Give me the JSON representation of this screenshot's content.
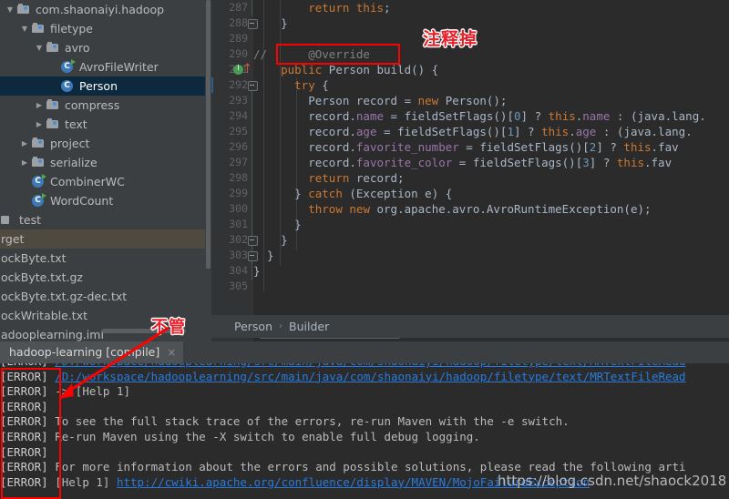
{
  "sidebar": {
    "tree": [
      {
        "depth": 0,
        "twisty": "▼",
        "icon": "folder-icon",
        "label": "com.shaonaiyi.hadoop",
        "state": "normal"
      },
      {
        "depth": 1,
        "twisty": "▼",
        "icon": "folder-icon",
        "label": "filetype",
        "state": "normal"
      },
      {
        "depth": 2,
        "twisty": "▼",
        "icon": "folder-icon",
        "label": "avro",
        "state": "normal"
      },
      {
        "depth": 3,
        "twisty": "",
        "icon": "java-class-runnable-icon",
        "label": "AvroFileWriter",
        "state": "normal"
      },
      {
        "depth": 3,
        "twisty": "",
        "icon": "java-class-icon",
        "label": "Person",
        "state": "selected"
      },
      {
        "depth": 2,
        "twisty": "▶",
        "icon": "folder-icon",
        "label": "compress",
        "state": "normal"
      },
      {
        "depth": 2,
        "twisty": "▶",
        "icon": "folder-icon",
        "label": "text",
        "state": "normal"
      },
      {
        "depth": 1,
        "twisty": "▶",
        "icon": "folder-icon",
        "label": "project",
        "state": "normal"
      },
      {
        "depth": 1,
        "twisty": "▶",
        "icon": "folder-icon",
        "label": "serialize",
        "state": "normal"
      },
      {
        "depth": 1,
        "twisty": "",
        "icon": "java-class-runnable-icon",
        "label": "CombinerWC",
        "state": "normal"
      },
      {
        "depth": 1,
        "twisty": "",
        "icon": "java-class-runnable-icon",
        "label": "WordCount",
        "state": "normal"
      }
    ],
    "files": [
      {
        "icon": "module-icon",
        "label": "test",
        "state": "normal"
      },
      {
        "icon": "none",
        "label": "rget",
        "state": "highlight"
      },
      {
        "icon": "none",
        "label": "ockByte.txt",
        "state": "normal"
      },
      {
        "icon": "none",
        "label": "ockByte.txt.gz",
        "state": "normal"
      },
      {
        "icon": "none",
        "label": "ockByte.txt.gz-dec.txt",
        "state": "normal"
      },
      {
        "icon": "none",
        "label": "ockWritable.txt",
        "state": "normal"
      },
      {
        "icon": "none",
        "label": "adooplearning.iml",
        "state": "normal"
      }
    ]
  },
  "editor": {
    "first_line_number": 287,
    "line_numbers": [
      287,
      288,
      289,
      290,
      291,
      292,
      293,
      294,
      295,
      296,
      297,
      298,
      299,
      300,
      301,
      302,
      303,
      304,
      305
    ],
    "lines": [
      "        return this;",
      "    }",
      "",
      "//      @Override",
      "    public Person build() {",
      "      try {",
      "        Person record = new Person();",
      "        record.name = fieldSetFlags()[0] ? this.name : (java.lang.",
      "        record.age = fieldSetFlags()[1] ? this.age : (java.lang.",
      "        record.favorite_number = fieldSetFlags()[2] ? this.fav",
      "        record.favorite_color = fieldSetFlags()[3] ? this.fav",
      "        return record;",
      "      } catch (Exception e) {",
      "        throw new org.apache.avro.AvroRuntimeException(e);",
      "      }",
      "    }",
      "  }",
      "}",
      ""
    ],
    "gutter": {
      "run_marker_line": 291,
      "override_marker_line": 291,
      "fold_lines": [
        288,
        291,
        302,
        303
      ]
    },
    "breadcrumb": [
      "Person",
      "Builder"
    ],
    "breadcrumb_separator": "›"
  },
  "tool_window": {
    "tab_label": "hadoop-learning [compile]",
    "tab_close": "×",
    "console_lines": [
      {
        "tag": "[ERROR]",
        "text": "/D:/workspace/hadooplearning/src/main/java/com/shaonaiyi/hadoop/filetype/text/MRTextFileRead",
        "link": true,
        "clipped_top": true
      },
      {
        "tag": "[ERROR]",
        "text": "/D:/workspace/hadooplearning/src/main/java/com/shaonaiyi/hadoop/filetype/text/MRTextFileRead",
        "link": true
      },
      {
        "tag": "[ERROR]",
        "text": "-> [Help 1]",
        "link": false
      },
      {
        "tag": "[ERROR]",
        "text": "",
        "link": false
      },
      {
        "tag": "[ERROR]",
        "text": "To see the full stack trace of the errors, re-run Maven with the -e switch.",
        "link": false
      },
      {
        "tag": "[ERROR]",
        "text": "Re-run Maven using the -X switch to enable full debug logging.",
        "link": false
      },
      {
        "tag": "[ERROR]",
        "text": "",
        "link": false
      },
      {
        "tag": "[ERROR]",
        "text": "For more information about the errors and possible solutions, please read the following arti",
        "link": false
      },
      {
        "tag": "[ERROR]",
        "text": "[Help 1] ",
        "link_text": "http://cwiki.apache.org/confluence/display/MAVEN/MojoFailureException",
        "link": false
      }
    ]
  },
  "annotations": {
    "comment_out_label": "注释掉",
    "ignore_label": "不管",
    "watermark": "https://blog.csdn.net/shaock2018"
  },
  "colors": {
    "accent_red": "#ff0000",
    "selection_blue": "#0d293e",
    "editor_bg": "#2b2b2b",
    "panel_bg": "#3c3f41",
    "link_blue": "#287bde",
    "keyword_orange": "#cc7832",
    "field_purple": "#9876aa",
    "number_blue": "#6897bb",
    "comment_gray": "#808080"
  }
}
